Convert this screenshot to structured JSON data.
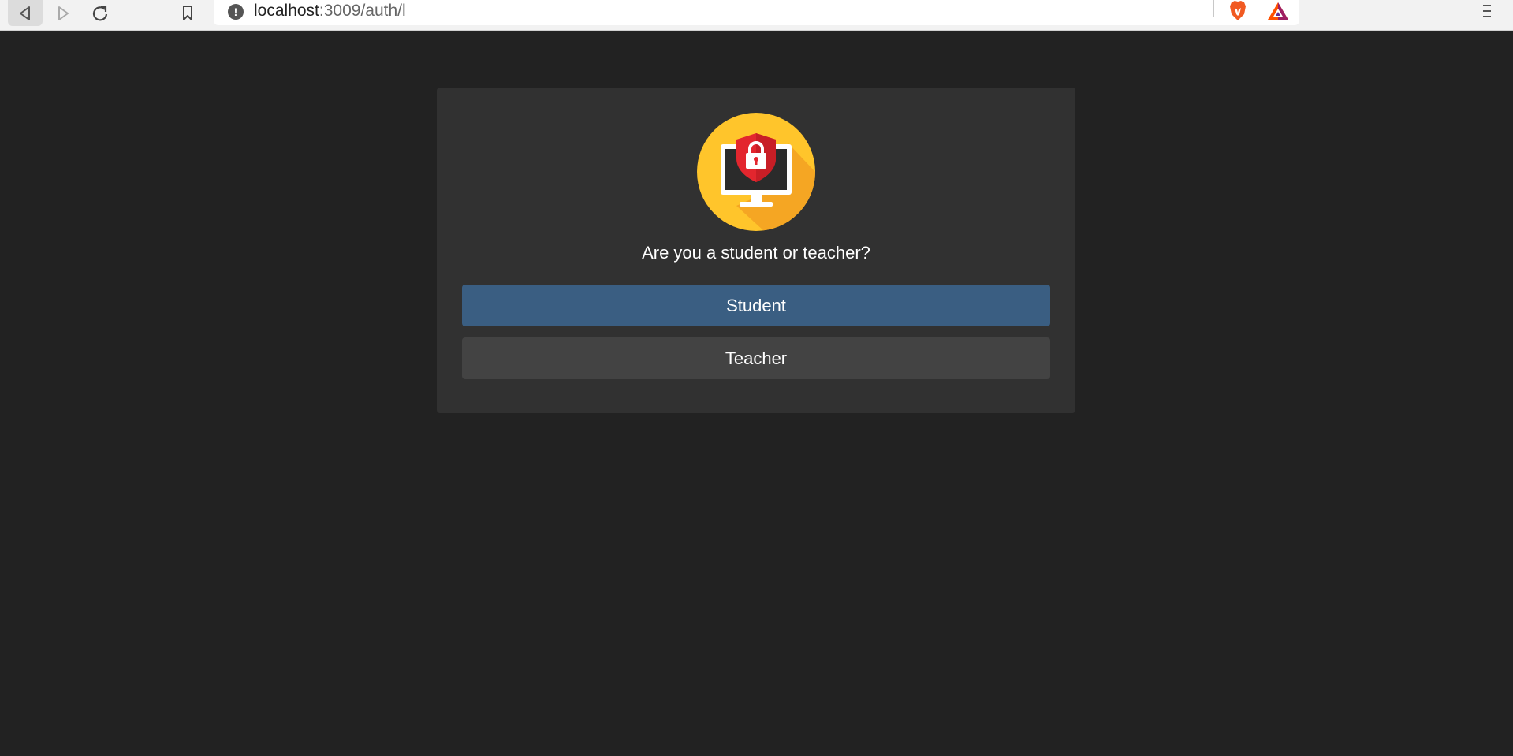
{
  "browser": {
    "url_host": "localhost",
    "url_path": ":3009/auth/l",
    "info_icon": "!",
    "icons": {
      "back": "back-icon",
      "forward": "forward-icon",
      "reload": "reload-icon",
      "bookmark": "bookmark-icon",
      "info": "info-icon",
      "brave": "brave-lion-icon",
      "rewards": "brave-rewards-icon",
      "menu": "hamburger-menu-icon"
    }
  },
  "colors": {
    "page_bg": "#222222",
    "card_bg": "#313131",
    "primary_button": "#3a5e82",
    "secondary_button": "#434343",
    "logo_circle": "#ffc52b",
    "shield_red": "#e3262e"
  },
  "auth": {
    "logo_icon": "monitor-shield-lock-icon",
    "question": "Are you a student or teacher?",
    "student_label": "Student",
    "teacher_label": "Teacher"
  }
}
